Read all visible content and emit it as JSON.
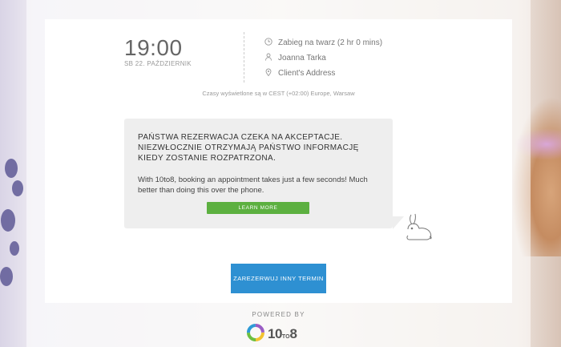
{
  "appointment": {
    "time": "19:00",
    "date": "SB 22. PAŹDZIERNIK",
    "service": "Zabieg na twarz (2 hr 0 mins)",
    "staff": "Joanna Tarka",
    "location": "Client's Address",
    "timezone_note": "Czasy wyświetlone są w CEST (+02:00) Europe, Warsaw"
  },
  "notice": {
    "title": "PAŃSTWA REZERWACJA CZEKA NA AKCEPTACJE. NIEZWŁOCZNIE OTRZYMAJĄ PAŃSTWO INFORMACJĘ KIEDY ZOSTANIE ROZPATRZONA.",
    "body": "With 10to8, booking an appointment takes just a few seconds! Much better than doing this over the phone.",
    "learn_more_label": "LEARN MORE"
  },
  "actions": {
    "book_again_label": "ZAREZERWUJ INNY TERMIN"
  },
  "footer": {
    "powered_by": "POWERED BY",
    "brand_main": "10",
    "brand_to": "TO",
    "brand_end": "8"
  },
  "colors": {
    "learn_more": "#5cb040",
    "book_button": "#2e90d2",
    "notice_bg": "#eeeeee"
  },
  "icons": [
    "clock-icon",
    "person-icon",
    "location-pin-icon",
    "rabbit-icon",
    "brand-ring-icon"
  ]
}
